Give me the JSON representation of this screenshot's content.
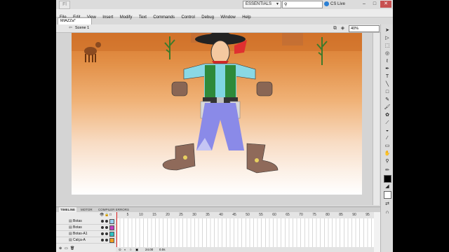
{
  "app": {
    "logo_text": "Fl",
    "workspace": "ESSENTIALS",
    "cs_live": "CS Live",
    "window_controls": [
      "–",
      "□",
      "✕"
    ]
  },
  "menu": [
    "File",
    "Edit",
    "View",
    "Insert",
    "Modify",
    "Text",
    "Commands",
    "Control",
    "Debug",
    "Window",
    "Help"
  ],
  "document_tab": "MIAZZa*",
  "scene_label": "Scene 1",
  "zoom": "40%",
  "panel_tabs": [
    "TIMELINE",
    "MOTOR",
    "COMPILER ERRORS"
  ],
  "timeline": {
    "frame_ticks": [
      "5",
      "10",
      "15",
      "20",
      "25",
      "30",
      "35",
      "40",
      "45",
      "50",
      "55",
      "60",
      "65",
      "70",
      "75",
      "80",
      "85",
      "90",
      "95"
    ],
    "layers": [
      {
        "name": "Botas",
        "color": "#9bd0f0"
      },
      {
        "name": "Botas",
        "color": "#c040c0"
      },
      {
        "name": "Botas-A1",
        "color": "#30c0c0"
      },
      {
        "name": "Calça-A",
        "color": "#f0a020"
      }
    ],
    "fps": "24.00",
    "time": "0.0s"
  },
  "colors": {
    "stroke": "#000000",
    "fill": "#ffffff"
  }
}
